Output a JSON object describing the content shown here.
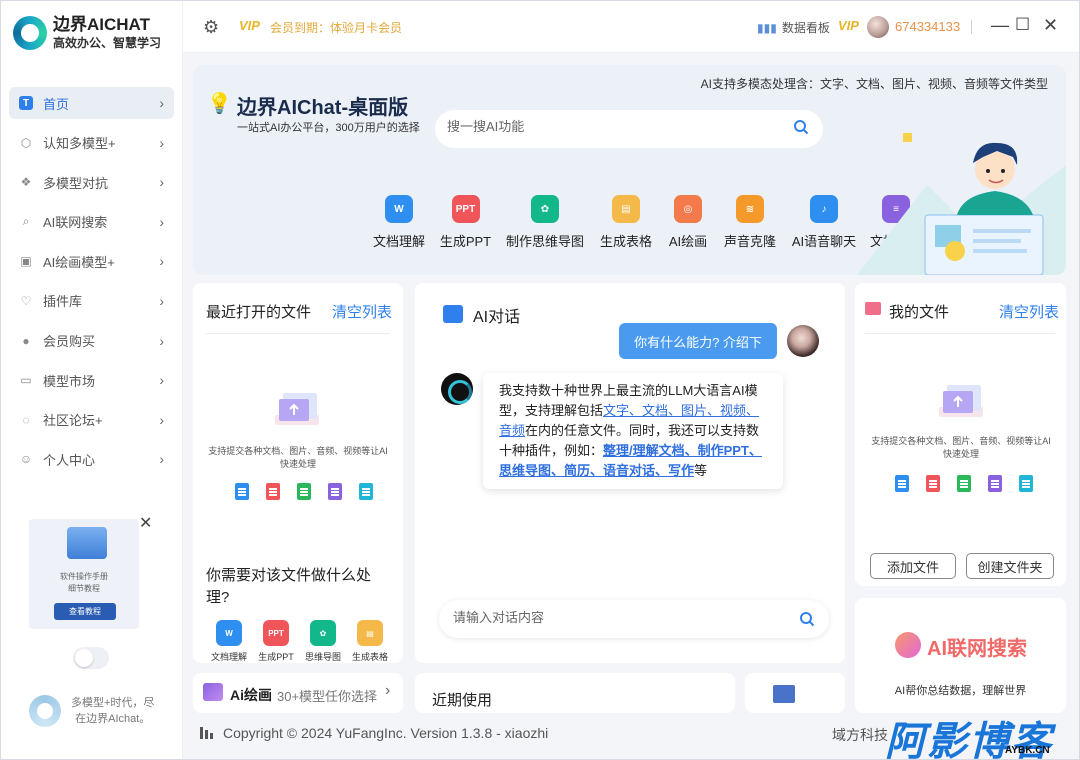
{
  "app": {
    "name": "边界AICHAT",
    "tagline": "高效办公、智慧学习"
  },
  "sidebar": {
    "items": [
      {
        "label": "首页",
        "icon": "home-icon",
        "active": true
      },
      {
        "label": "认知多模型+",
        "icon": "cube-icon"
      },
      {
        "label": "多模型对抗",
        "icon": "diamond-grid-icon"
      },
      {
        "label": "AI联网搜索",
        "icon": "search-icon"
      },
      {
        "label": "AI绘画模型+",
        "icon": "image-icon"
      },
      {
        "label": "插件库",
        "icon": "bulb-icon"
      },
      {
        "label": "会员购买",
        "icon": "user-icon"
      },
      {
        "label": "模型市场",
        "icon": "bag-icon"
      },
      {
        "label": "社区论坛+",
        "icon": "chat-icon"
      },
      {
        "label": "个人中心",
        "icon": "person-icon"
      }
    ],
    "promo": {
      "line1": "软件操作手册",
      "line2": "细节教程",
      "button": "查看教程"
    },
    "footer": {
      "line1": "多模型+时代，尽",
      "line2": "在边界AIchat。"
    }
  },
  "topbar": {
    "vip_badge": "VIP",
    "member_status": "会员到期：体验月卡会员",
    "dashboard": "数据看板",
    "user_id": "674334133"
  },
  "hero": {
    "capability_text": "AI支持多模态处理含：文字、文档、图片、视频、音频等文件类型",
    "title": "边界AIChat-桌面版",
    "subtitle": "一站式AI办公平台，300万用户的选择",
    "search_placeholder": "搜一搜AI功能",
    "tools": [
      {
        "label": "文档理解",
        "color": "#2f8ff0",
        "glyph": "W"
      },
      {
        "label": "生成PPT",
        "color": "#f0555a",
        "glyph": "PPT"
      },
      {
        "label": "制作思维导图",
        "color": "#12b88a",
        "glyph": "✿"
      },
      {
        "label": "生成表格",
        "color": "#f5b94a",
        "glyph": "▤"
      },
      {
        "label": "AI绘画",
        "color": "#f47a4c",
        "glyph": "◎"
      },
      {
        "label": "声音克隆",
        "color": "#f59a2a",
        "glyph": "≋"
      },
      {
        "label": "AI语音聊天",
        "color": "#2f8ff0",
        "glyph": "♪"
      },
      {
        "label": "文档翻译",
        "color": "#8a62e0",
        "glyph": "≡"
      }
    ]
  },
  "recent": {
    "title": "最近打开的文件",
    "clear": "清空列表",
    "hint_line1": "支持提交各种文档、图片、音频、视频等让AI",
    "hint_line2": "快速处理",
    "question": "你需要对该文件做什么处理?",
    "quick_tools": [
      {
        "label": "文档理解",
        "color": "#2f8ff0",
        "glyph": "W"
      },
      {
        "label": "生成PPT",
        "color": "#f0555a",
        "glyph": "PPT"
      },
      {
        "label": "思维导图",
        "color": "#12b88a",
        "glyph": "✿"
      },
      {
        "label": "生成表格",
        "color": "#f5b94a",
        "glyph": "▤"
      }
    ]
  },
  "drawing": {
    "title": "Ai绘画",
    "subtitle": "30+模型任你选择"
  },
  "chat": {
    "title": "AI对话",
    "user_message": "你有什么能力? 介绍下",
    "bot_parts": {
      "p1": "我支持数十种世界上最主流的LLM大语言AI模型，支持理解包括",
      "link1": "文字、文档、图片、视频、音频",
      "p2": "在内的任意文件。同时，我还可以支持数十种插件，例如：",
      "link2": "整理/理解文档、制作PPT、思维导图、简历、语音对话、写作",
      "p3": "等"
    },
    "input_placeholder": "请输入对话内容"
  },
  "recent_use": {
    "title": "近期使用"
  },
  "my_files": {
    "title": "我的文件",
    "clear": "清空列表",
    "hint_line1": "支持提交各种文档、图片、音频、视频等让AI",
    "hint_line2": "快速处理",
    "add_button": "添加文件",
    "create_button": "创建文件夹"
  },
  "web_search_card": {
    "title": "AI联网搜索",
    "subtitle": "AI帮你总结数据，理解世界"
  },
  "footer": {
    "copyright": "Copyright © 2024 YuFangInc. Version 1.3.8 - xiaozhi",
    "company": "域方科技"
  },
  "watermark": {
    "text": "阿影博客",
    "domain": "AYBK.CN"
  },
  "colors": {
    "accent": "#2f80ed",
    "member_orange": "#e3a93a",
    "background": "#f3f5f9"
  }
}
